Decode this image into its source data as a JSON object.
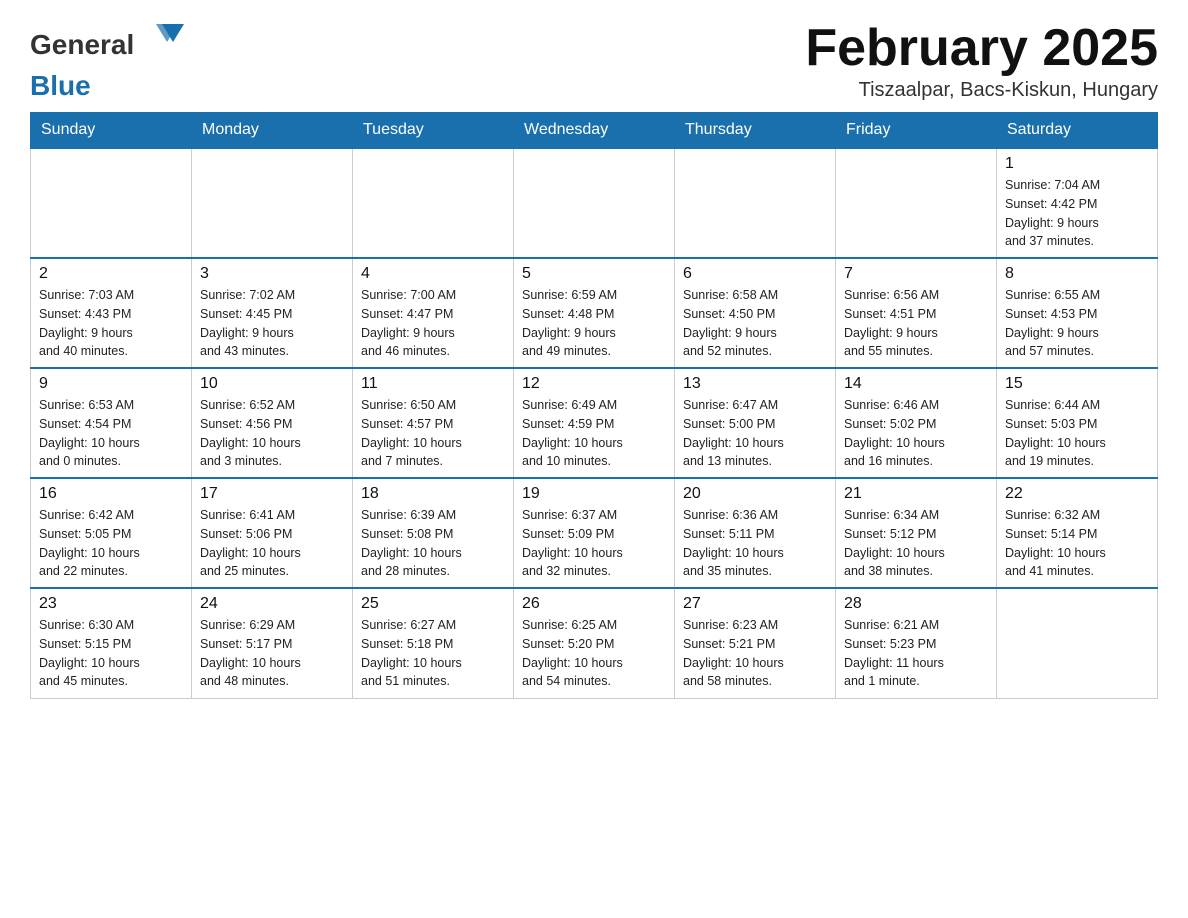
{
  "header": {
    "logo_general": "General",
    "logo_blue": "Blue",
    "month_title": "February 2025",
    "subtitle": "Tiszaalpar, Bacs-Kiskun, Hungary"
  },
  "weekdays": [
    "Sunday",
    "Monday",
    "Tuesday",
    "Wednesday",
    "Thursday",
    "Friday",
    "Saturday"
  ],
  "weeks": [
    [
      {
        "day": "",
        "info": ""
      },
      {
        "day": "",
        "info": ""
      },
      {
        "day": "",
        "info": ""
      },
      {
        "day": "",
        "info": ""
      },
      {
        "day": "",
        "info": ""
      },
      {
        "day": "",
        "info": ""
      },
      {
        "day": "1",
        "info": "Sunrise: 7:04 AM\nSunset: 4:42 PM\nDaylight: 9 hours\nand 37 minutes."
      }
    ],
    [
      {
        "day": "2",
        "info": "Sunrise: 7:03 AM\nSunset: 4:43 PM\nDaylight: 9 hours\nand 40 minutes."
      },
      {
        "day": "3",
        "info": "Sunrise: 7:02 AM\nSunset: 4:45 PM\nDaylight: 9 hours\nand 43 minutes."
      },
      {
        "day": "4",
        "info": "Sunrise: 7:00 AM\nSunset: 4:47 PM\nDaylight: 9 hours\nand 46 minutes."
      },
      {
        "day": "5",
        "info": "Sunrise: 6:59 AM\nSunset: 4:48 PM\nDaylight: 9 hours\nand 49 minutes."
      },
      {
        "day": "6",
        "info": "Sunrise: 6:58 AM\nSunset: 4:50 PM\nDaylight: 9 hours\nand 52 minutes."
      },
      {
        "day": "7",
        "info": "Sunrise: 6:56 AM\nSunset: 4:51 PM\nDaylight: 9 hours\nand 55 minutes."
      },
      {
        "day": "8",
        "info": "Sunrise: 6:55 AM\nSunset: 4:53 PM\nDaylight: 9 hours\nand 57 minutes."
      }
    ],
    [
      {
        "day": "9",
        "info": "Sunrise: 6:53 AM\nSunset: 4:54 PM\nDaylight: 10 hours\nand 0 minutes."
      },
      {
        "day": "10",
        "info": "Sunrise: 6:52 AM\nSunset: 4:56 PM\nDaylight: 10 hours\nand 3 minutes."
      },
      {
        "day": "11",
        "info": "Sunrise: 6:50 AM\nSunset: 4:57 PM\nDaylight: 10 hours\nand 7 minutes."
      },
      {
        "day": "12",
        "info": "Sunrise: 6:49 AM\nSunset: 4:59 PM\nDaylight: 10 hours\nand 10 minutes."
      },
      {
        "day": "13",
        "info": "Sunrise: 6:47 AM\nSunset: 5:00 PM\nDaylight: 10 hours\nand 13 minutes."
      },
      {
        "day": "14",
        "info": "Sunrise: 6:46 AM\nSunset: 5:02 PM\nDaylight: 10 hours\nand 16 minutes."
      },
      {
        "day": "15",
        "info": "Sunrise: 6:44 AM\nSunset: 5:03 PM\nDaylight: 10 hours\nand 19 minutes."
      }
    ],
    [
      {
        "day": "16",
        "info": "Sunrise: 6:42 AM\nSunset: 5:05 PM\nDaylight: 10 hours\nand 22 minutes."
      },
      {
        "day": "17",
        "info": "Sunrise: 6:41 AM\nSunset: 5:06 PM\nDaylight: 10 hours\nand 25 minutes."
      },
      {
        "day": "18",
        "info": "Sunrise: 6:39 AM\nSunset: 5:08 PM\nDaylight: 10 hours\nand 28 minutes."
      },
      {
        "day": "19",
        "info": "Sunrise: 6:37 AM\nSunset: 5:09 PM\nDaylight: 10 hours\nand 32 minutes."
      },
      {
        "day": "20",
        "info": "Sunrise: 6:36 AM\nSunset: 5:11 PM\nDaylight: 10 hours\nand 35 minutes."
      },
      {
        "day": "21",
        "info": "Sunrise: 6:34 AM\nSunset: 5:12 PM\nDaylight: 10 hours\nand 38 minutes."
      },
      {
        "day": "22",
        "info": "Sunrise: 6:32 AM\nSunset: 5:14 PM\nDaylight: 10 hours\nand 41 minutes."
      }
    ],
    [
      {
        "day": "23",
        "info": "Sunrise: 6:30 AM\nSunset: 5:15 PM\nDaylight: 10 hours\nand 45 minutes."
      },
      {
        "day": "24",
        "info": "Sunrise: 6:29 AM\nSunset: 5:17 PM\nDaylight: 10 hours\nand 48 minutes."
      },
      {
        "day": "25",
        "info": "Sunrise: 6:27 AM\nSunset: 5:18 PM\nDaylight: 10 hours\nand 51 minutes."
      },
      {
        "day": "26",
        "info": "Sunrise: 6:25 AM\nSunset: 5:20 PM\nDaylight: 10 hours\nand 54 minutes."
      },
      {
        "day": "27",
        "info": "Sunrise: 6:23 AM\nSunset: 5:21 PM\nDaylight: 10 hours\nand 58 minutes."
      },
      {
        "day": "28",
        "info": "Sunrise: 6:21 AM\nSunset: 5:23 PM\nDaylight: 11 hours\nand 1 minute."
      },
      {
        "day": "",
        "info": ""
      }
    ]
  ]
}
